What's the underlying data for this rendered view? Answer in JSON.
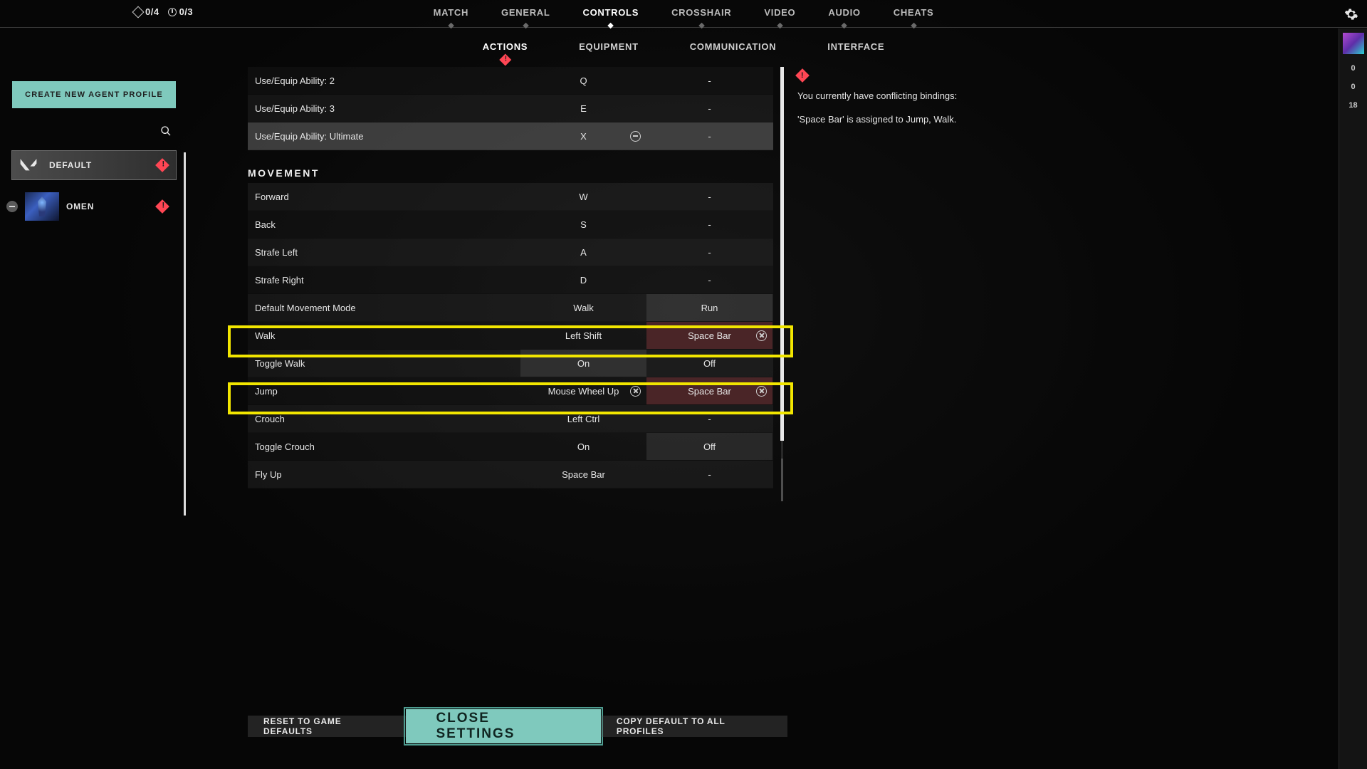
{
  "hud": {
    "counter1": "0/4",
    "counter2": "0/3"
  },
  "tabs": {
    "main": [
      "MATCH",
      "GENERAL",
      "CONTROLS",
      "CROSSHAIR",
      "VIDEO",
      "AUDIO",
      "CHEATS"
    ],
    "sub": [
      "ACTIONS",
      "EQUIPMENT",
      "COMMUNICATION",
      "INTERFACE"
    ]
  },
  "left": {
    "create": "CREATE NEW AGENT PROFILE",
    "profiles": [
      "DEFAULT",
      "OMEN"
    ]
  },
  "rows": [
    {
      "type": "bind",
      "label": "Use/Equip Ability: 2",
      "b1": "Q",
      "b2": "-",
      "alt": false
    },
    {
      "type": "bind",
      "label": "Use/Equip Ability: 3",
      "b1": "E",
      "b2": "-",
      "alt": true
    },
    {
      "type": "bind",
      "label": "Use/Equip Ability: Ultimate",
      "b1": "X",
      "b2": "-",
      "hov": true,
      "clear1": "minus"
    },
    {
      "type": "section",
      "label": "MOVEMENT"
    },
    {
      "type": "bind",
      "label": "Forward",
      "b1": "W",
      "b2": "-",
      "alt": true
    },
    {
      "type": "bind",
      "label": "Back",
      "b1": "S",
      "b2": "-",
      "alt": false
    },
    {
      "type": "bind",
      "label": "Strafe Left",
      "b1": "A",
      "b2": "-",
      "alt": true
    },
    {
      "type": "bind",
      "label": "Strafe Right",
      "b1": "D",
      "b2": "-",
      "alt": false
    },
    {
      "type": "toggle",
      "label": "Default Movement Mode",
      "b1": "Walk",
      "b2": "Run",
      "sel": 2,
      "alt": true
    },
    {
      "type": "bind",
      "label": "Walk",
      "b1": "Left Shift",
      "b2": "Space Bar",
      "alt": false,
      "conflict2": true,
      "clear2": "x",
      "hlid": "hl1"
    },
    {
      "type": "toggle",
      "label": "Toggle Walk",
      "b1": "On",
      "b2": "Off",
      "sel": 1,
      "alt": true
    },
    {
      "type": "bind",
      "label": "Jump",
      "b1": "Mouse Wheel Up",
      "b2": "Space Bar",
      "alt": false,
      "conflict2": true,
      "clear1": "x",
      "clear2": "x",
      "hlid": "hl2"
    },
    {
      "type": "bind",
      "label": "Crouch",
      "b1": "Left Ctrl",
      "b2": "-",
      "alt": true
    },
    {
      "type": "toggle",
      "label": "Toggle Crouch",
      "b1": "On",
      "b2": "Off",
      "sel": 2,
      "alt": false
    },
    {
      "type": "bind",
      "label": "Fly Up",
      "b1": "Space Bar",
      "b2": "-",
      "alt": true
    }
  ],
  "warning": {
    "line1": "You currently have conflicting bindings:",
    "line2": "'Space Bar' is assigned to Jump, Walk."
  },
  "footer": {
    "reset": "RESET TO GAME DEFAULTS",
    "close": "CLOSE SETTINGS",
    "copy": "COPY DEFAULT TO ALL PROFILES"
  },
  "rail": [
    "0",
    "0",
    "18"
  ]
}
